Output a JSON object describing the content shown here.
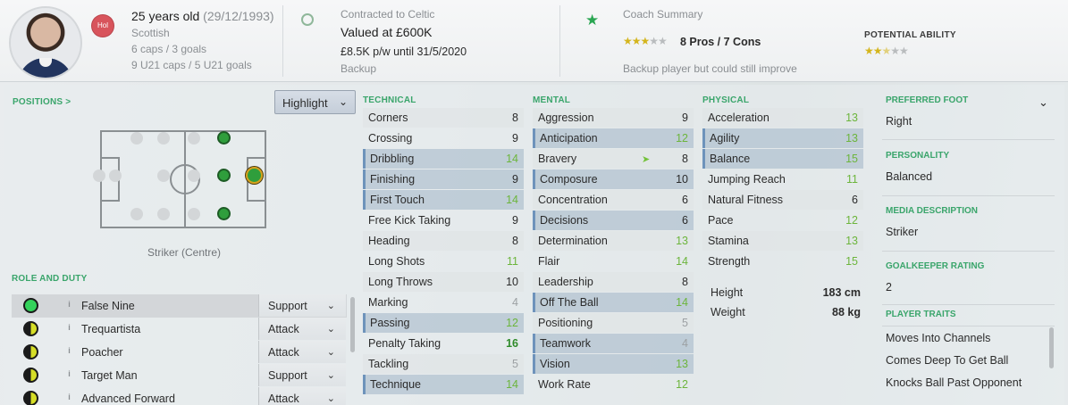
{
  "header": {
    "age": "25 years old",
    "dob": "(29/12/1993)",
    "flag_code": "Hol",
    "nationality": "Scottish",
    "caps": "6 caps / 3 goals",
    "u21": "9 U21 caps / 5 U21 goals",
    "contract_label": "Contracted to Celtic",
    "value": "Valued at £600K",
    "wage": "£8.5K p/w until 31/5/2020",
    "status": "Backup",
    "coach_title": "Coach Summary",
    "coach_stars": 3,
    "pros_cons": "8 Pros / 7 Cons",
    "coach_note": "Backup player but could still improve",
    "pa_label": "POTENTIAL ABILITY",
    "pa_stars": 2.5
  },
  "positions": {
    "title": "POSITIONS >",
    "highlight_label": "Highlight",
    "caption": "Striker (Centre)"
  },
  "roles": {
    "title": "ROLE AND DUTY",
    "items": [
      {
        "name": "False Nine",
        "duty": "Support"
      },
      {
        "name": "Trequartista",
        "duty": "Attack"
      },
      {
        "name": "Poacher",
        "duty": "Attack"
      },
      {
        "name": "Target Man",
        "duty": "Support"
      },
      {
        "name": "Advanced Forward",
        "duty": "Attack"
      }
    ]
  },
  "attributes": {
    "technical_title": "TECHNICAL",
    "mental_title": "MENTAL",
    "physical_title": "PHYSICAL",
    "technical": [
      {
        "name": "Corners",
        "value": "8"
      },
      {
        "name": "Crossing",
        "value": "9"
      },
      {
        "name": "Dribbling",
        "value": "14"
      },
      {
        "name": "Finishing",
        "value": "9"
      },
      {
        "name": "First Touch",
        "value": "14"
      },
      {
        "name": "Free Kick Taking",
        "value": "9"
      },
      {
        "name": "Heading",
        "value": "8"
      },
      {
        "name": "Long Shots",
        "value": "11"
      },
      {
        "name": "Long Throws",
        "value": "10"
      },
      {
        "name": "Marking",
        "value": "4"
      },
      {
        "name": "Passing",
        "value": "12"
      },
      {
        "name": "Penalty Taking",
        "value": "16"
      },
      {
        "name": "Tackling",
        "value": "5"
      },
      {
        "name": "Technique",
        "value": "14"
      }
    ],
    "mental": [
      {
        "name": "Aggression",
        "value": "9"
      },
      {
        "name": "Anticipation",
        "value": "12"
      },
      {
        "name": "Bravery",
        "value": "8"
      },
      {
        "name": "Composure",
        "value": "10"
      },
      {
        "name": "Concentration",
        "value": "6"
      },
      {
        "name": "Decisions",
        "value": "6"
      },
      {
        "name": "Determination",
        "value": "13"
      },
      {
        "name": "Flair",
        "value": "14"
      },
      {
        "name": "Leadership",
        "value": "8"
      },
      {
        "name": "Off The Ball",
        "value": "14"
      },
      {
        "name": "Positioning",
        "value": "5"
      },
      {
        "name": "Teamwork",
        "value": "4"
      },
      {
        "name": "Vision",
        "value": "13"
      },
      {
        "name": "Work Rate",
        "value": "12"
      }
    ],
    "physical": [
      {
        "name": "Acceleration",
        "value": "13"
      },
      {
        "name": "Agility",
        "value": "13"
      },
      {
        "name": "Balance",
        "value": "15"
      },
      {
        "name": "Jumping Reach",
        "value": "11"
      },
      {
        "name": "Natural Fitness",
        "value": "6"
      },
      {
        "name": "Pace",
        "value": "12"
      },
      {
        "name": "Stamina",
        "value": "13"
      },
      {
        "name": "Strength",
        "value": "15"
      }
    ],
    "height_label": "Height",
    "height": "183 cm",
    "weight_label": "Weight",
    "weight": "88 kg"
  },
  "side": {
    "foot_label": "PREFERRED FOOT",
    "foot": "Right",
    "personality_label": "PERSONALITY",
    "personality": "Balanced",
    "media_label": "MEDIA DESCRIPTION",
    "media": "Striker",
    "gk_label": "GOALKEEPER RATING",
    "gk": "2",
    "traits_label": "PLAYER TRAITS",
    "traits": [
      "Moves Into Channels",
      "Comes Deep To Get Ball",
      "Knocks Ball Past Opponent"
    ]
  }
}
